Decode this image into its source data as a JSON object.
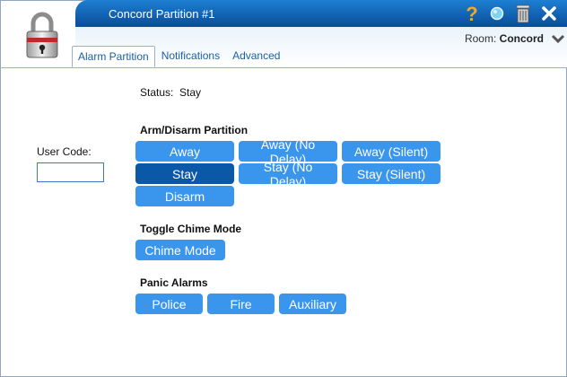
{
  "titlebar": {
    "title": "Concord Partition #1",
    "icons": [
      "help-icon",
      "info-bubble-icon",
      "trash-icon",
      "close-icon"
    ]
  },
  "header": {
    "room_label": "Room:",
    "room_value": "Concord"
  },
  "tabs": [
    {
      "label": "Alarm Partition",
      "active": true
    },
    {
      "label": "Notifications",
      "active": false
    },
    {
      "label": "Advanced",
      "active": false
    }
  ],
  "status": {
    "label": "Status:",
    "value": "Stay"
  },
  "user_code": {
    "label": "User Code:",
    "value": ""
  },
  "arm_section": {
    "title": "Arm/Disarm Partition",
    "buttons": [
      {
        "label": "Away",
        "selected": false
      },
      {
        "label": "Away (No Delay)",
        "selected": false
      },
      {
        "label": "Away (Silent)",
        "selected": false
      },
      {
        "label": "Stay",
        "selected": true
      },
      {
        "label": "Stay (No Delay)",
        "selected": false
      },
      {
        "label": "Stay (Silent)",
        "selected": false
      },
      {
        "label": "Disarm",
        "selected": false
      }
    ]
  },
  "chime_section": {
    "title": "Toggle Chime Mode",
    "button": "Chime Mode"
  },
  "panic_section": {
    "title": "Panic Alarms",
    "buttons": [
      "Police",
      "Fire",
      "Auxiliary"
    ]
  },
  "colors": {
    "titlebar": "#0a4c97",
    "button": "#3a95ec",
    "button_selected": "#0b58a8"
  }
}
